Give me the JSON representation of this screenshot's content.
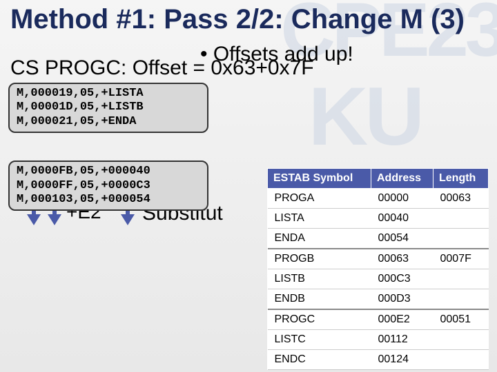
{
  "watermarks": {
    "w1": "CPE23",
    "w2": "KU"
  },
  "title": "Method #1: Pass 2/2: Change M (3)",
  "bullet": "• Offsets add up!",
  "offset_line": "CS PROGC: Offset = 0x63+0x7F",
  "code_top": {
    "l1": "M,000019,05,+LISTA",
    "l2": "M,00001D,05,+LISTB",
    "l3": "M,000021,05,+ENDA"
  },
  "plus_e2": "+E2",
  "substitut": "Substitut",
  "code_bottom": {
    "l1": "M,0000FB,05,+000040",
    "l2": "M,0000FF,05,+0000C3",
    "l3": "M,000103,05,+000054"
  },
  "table": {
    "h1": "ESTAB Symbol",
    "h2": "Address",
    "h3": "Length",
    "rows": [
      {
        "c1": "PROGA",
        "c2": "00000",
        "c3": "00063"
      },
      {
        "c1": "LISTA",
        "c2": "00040",
        "c3": ""
      },
      {
        "c1": "ENDA",
        "c2": "00054",
        "c3": ""
      },
      {
        "c1": "PROGB",
        "c2": "00063",
        "c3": "0007F"
      },
      {
        "c1": "LISTB",
        "c2": "000C3",
        "c3": ""
      },
      {
        "c1": "ENDB",
        "c2": "000D3",
        "c3": ""
      },
      {
        "c1": "PROGC",
        "c2": "000E2",
        "c3": "00051"
      },
      {
        "c1": "LISTC",
        "c2": "00112",
        "c3": ""
      },
      {
        "c1": "ENDC",
        "c2": "00124",
        "c3": ""
      }
    ]
  }
}
